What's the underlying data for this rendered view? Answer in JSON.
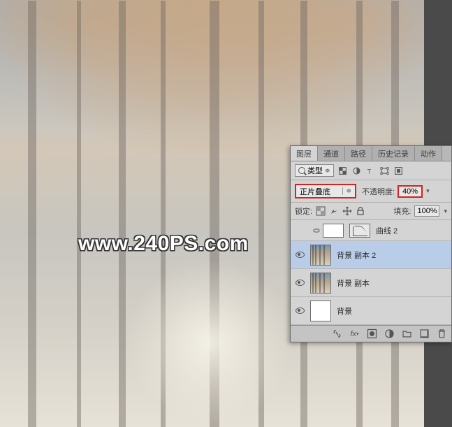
{
  "watermark": "www.240PS.com",
  "panel": {
    "tabs": [
      "图层",
      "通道",
      "路径",
      "历史记录",
      "动作"
    ],
    "active_tab": 0,
    "filter_label": "类型",
    "blend_mode": "正片叠底",
    "opacity_label": "不透明度:",
    "opacity_value": "40%",
    "lock_label": "锁定:",
    "fill_label": "填充:",
    "fill_value": "100%",
    "layers": [
      {
        "name": "曲线 2",
        "type": "adjustment",
        "visible": false
      },
      {
        "name": "背景 副本 2",
        "type": "image",
        "visible": true,
        "selected": true
      },
      {
        "name": "背景 副本",
        "type": "image",
        "visible": true
      },
      {
        "name": "背景",
        "type": "solid",
        "visible": true
      }
    ]
  }
}
